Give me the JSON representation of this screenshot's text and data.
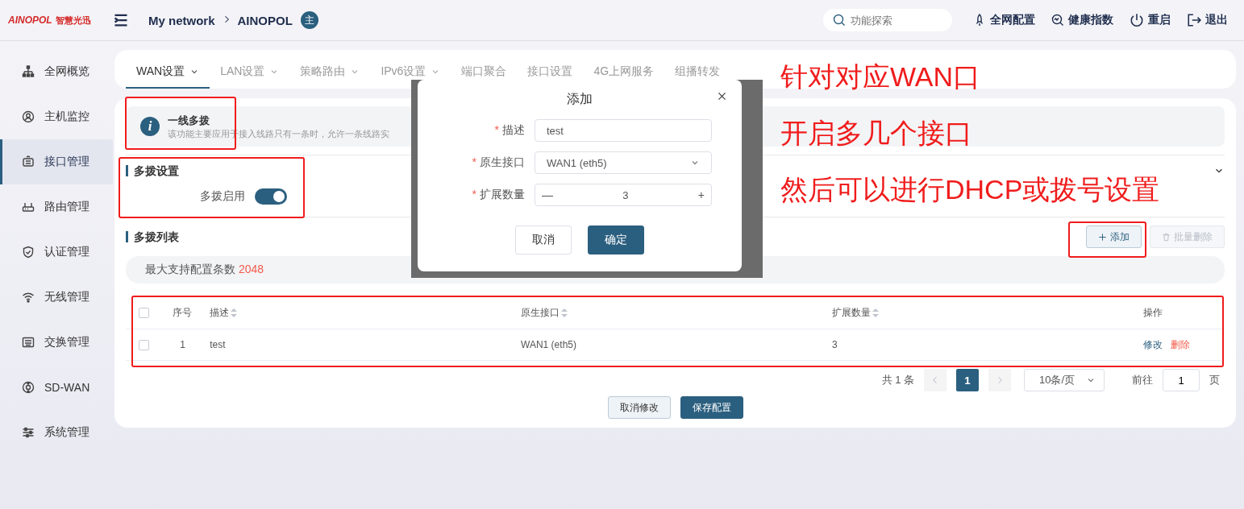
{
  "brand": {
    "logo": "AINOPOL",
    "tagline": "智慧光迅"
  },
  "header": {
    "breadcrumb": [
      "My network",
      "AINOPOL"
    ],
    "avatar": "主",
    "search_placeholder": "功能探索",
    "actions": [
      {
        "kind": "rocket",
        "label": "全网配置"
      },
      {
        "kind": "health",
        "label": "健康指数"
      },
      {
        "kind": "power",
        "label": "重启"
      },
      {
        "kind": "logout",
        "label": "退出"
      }
    ]
  },
  "sidebar": {
    "items": [
      {
        "kind": "tree",
        "label": "全网概览",
        "selected": false
      },
      {
        "kind": "user",
        "label": "主机监控",
        "selected": false
      },
      {
        "kind": "port",
        "label": "接口管理",
        "selected": true
      },
      {
        "kind": "router",
        "label": "路由管理",
        "selected": false
      },
      {
        "kind": "shield",
        "label": "认证管理",
        "selected": false
      },
      {
        "kind": "wifi",
        "label": "无线管理",
        "selected": false
      },
      {
        "kind": "switch",
        "label": "交换管理",
        "selected": false
      },
      {
        "kind": "sdwan",
        "label": "SD-WAN",
        "selected": false
      },
      {
        "kind": "sliders",
        "label": "系统管理",
        "selected": false
      }
    ]
  },
  "tabs": [
    {
      "label": "WAN设置",
      "dropdown": true,
      "selected": true
    },
    {
      "label": "LAN设置",
      "dropdown": true,
      "selected": false
    },
    {
      "label": "策略路由",
      "dropdown": true,
      "selected": false
    },
    {
      "label": "IPv6设置",
      "dropdown": true,
      "selected": false
    },
    {
      "label": "端口聚合",
      "dropdown": false,
      "selected": false
    },
    {
      "label": "接口设置",
      "dropdown": false,
      "selected": false
    },
    {
      "label": "4G上网服务",
      "dropdown": false,
      "selected": false
    },
    {
      "label": "组播转发",
      "dropdown": false,
      "selected": false
    }
  ],
  "notice": {
    "icon": "i",
    "title": "一线多拨",
    "text": "该功能主要应用于接入线路只有一条时，允许一条线路实"
  },
  "multi_dial": {
    "title": "多拨设置",
    "toggle": {
      "label": "多拨启用",
      "on": true
    }
  },
  "list": {
    "title": "多拨列表",
    "buttons": [
      {
        "label": "添加",
        "kind": "add",
        "disabled": false
      },
      {
        "label": "批量删除",
        "kind": "delete",
        "disabled": true
      }
    ],
    "max_label": "最大支持配置条数",
    "max_value": "2048"
  },
  "table": {
    "columns": [
      {
        "label": "序号",
        "sortable": false
      },
      {
        "label": "描述",
        "sortable": true
      },
      {
        "label": "原生接口",
        "sortable": true
      },
      {
        "label": "扩展数量",
        "sortable": true
      },
      {
        "label": "操作",
        "sortable": false
      }
    ],
    "header_checked": false,
    "rows": [
      {
        "checked": false,
        "cells": [
          "1",
          "test",
          "WAN1 (eth5)",
          "3"
        ],
        "actions": [
          {
            "label": "修改",
            "kind": "edit"
          },
          {
            "label": "删除",
            "kind": "delete"
          }
        ]
      }
    ]
  },
  "pagination": {
    "total": "共 1 条",
    "pages": [
      {
        "label": "1",
        "selected": true
      }
    ],
    "page_size": "10条/页",
    "goto_label": "前往",
    "goto_value": "1",
    "goto_suffix": "页"
  },
  "footer_buttons": [
    {
      "label": "取消修改",
      "kind": "secondary"
    },
    {
      "label": "保存配置",
      "kind": "primary"
    }
  ],
  "dialog": {
    "title": "添加",
    "required_mark": "*",
    "fields": [
      {
        "kind": "text",
        "label": "描述",
        "required": true,
        "value": "test"
      },
      {
        "kind": "select",
        "label": "原生接口",
        "required": true,
        "value": "WAN1 (eth5)"
      },
      {
        "kind": "number",
        "label": "扩展数量",
        "required": true,
        "value": "3",
        "minus": "—",
        "plus": "+"
      }
    ],
    "buttons": [
      {
        "label": "取消",
        "kind": "secondary"
      },
      {
        "label": "确定",
        "kind": "primary"
      }
    ]
  },
  "annotations": [
    "针对对应WAN口",
    "开启多几个接口",
    "然后可以进行DHCP或拨号设置"
  ]
}
